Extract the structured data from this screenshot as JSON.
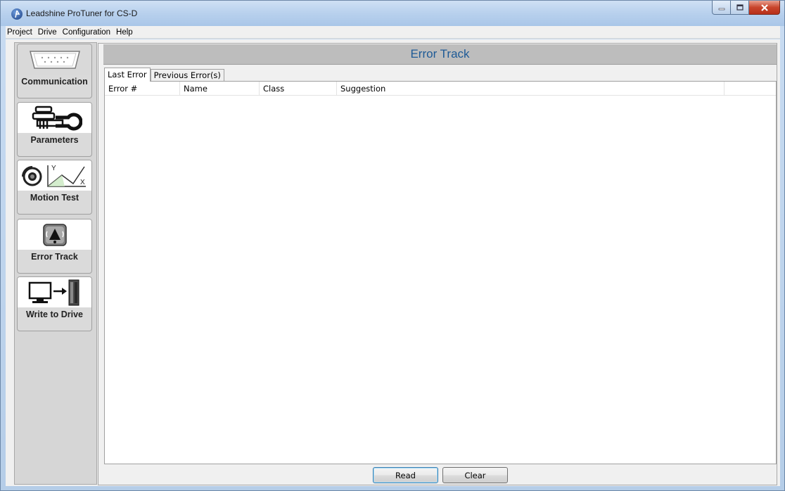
{
  "window": {
    "title": "Leadshine ProTuner for CS-D"
  },
  "menu": [
    "Project",
    "Drive",
    "Configuration",
    "Help"
  ],
  "sidebar": {
    "items": [
      {
        "label": "Communication",
        "icon": "serial-port-icon",
        "active": true
      },
      {
        "label": "Parameters",
        "icon": "parameters-wrench-icon",
        "active": false
      },
      {
        "label": "Motion Test",
        "icon": "motion-test-graph-icon",
        "active": false
      },
      {
        "label": "Error Track",
        "icon": "alarm-bell-icon",
        "active": false
      },
      {
        "label": "Write to Drive",
        "icon": "pc-to-drive-icon",
        "active": false
      }
    ]
  },
  "main": {
    "title": "Error Track",
    "tabs": [
      {
        "label": "Last Error",
        "active": true
      },
      {
        "label": "Previous Error(s)",
        "active": false
      }
    ],
    "table": {
      "columns": [
        "Error #",
        "Name",
        "Class",
        "Suggestion",
        ""
      ],
      "rows": []
    },
    "buttons": {
      "read": "Read",
      "clear": "Clear"
    }
  },
  "colors": {
    "header_text": "#1e5a96",
    "close_button": "#c8452c"
  }
}
